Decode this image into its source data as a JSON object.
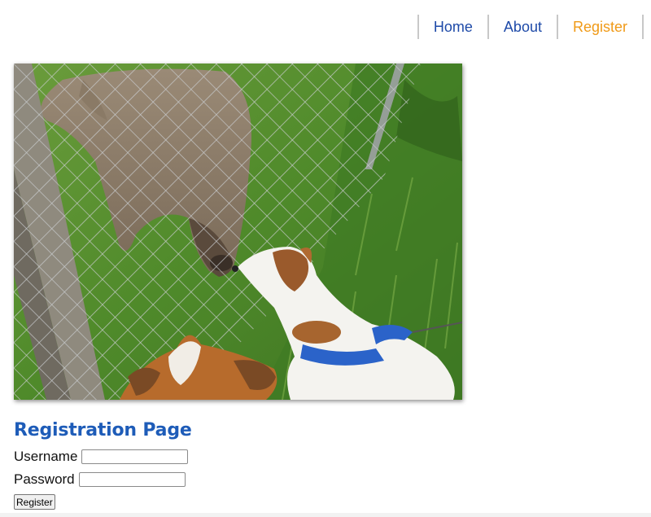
{
  "nav": {
    "items": [
      {
        "label": "Home",
        "active": false
      },
      {
        "label": "About",
        "active": false
      },
      {
        "label": "Register",
        "active": true
      }
    ],
    "link_color": "#1e4aa8",
    "active_color": "#f09a17"
  },
  "photo": {
    "alt": "Donkey and dogs at a wire fence"
  },
  "page": {
    "title": "Registration Page",
    "title_color": "#1e5cb8"
  },
  "form": {
    "username_label": "Username",
    "username_value": "",
    "password_label": "Password",
    "password_value": "",
    "submit_label": "Register"
  }
}
